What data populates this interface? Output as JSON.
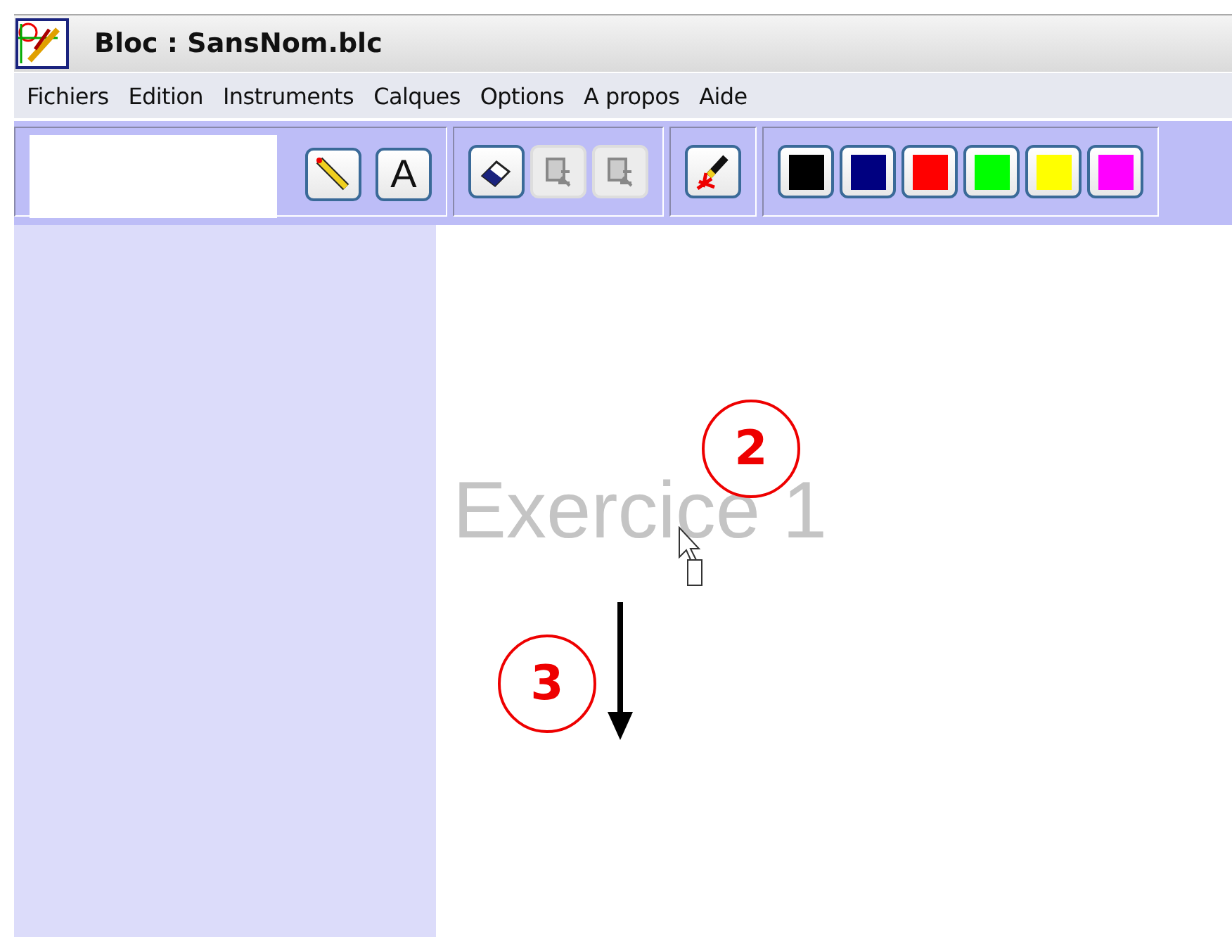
{
  "window": {
    "title": "Bloc : SansNom.blc"
  },
  "menu": [
    "Fichiers",
    "Edition",
    "Instruments",
    "Calques",
    "Options",
    "A propos",
    "Aide"
  ],
  "toolbar": {
    "tool_groups": [
      {
        "tools": [
          {
            "kind": "pencil",
            "disabled": false
          },
          {
            "kind": "text",
            "label": "A",
            "disabled": false
          }
        ]
      },
      {
        "tools": [
          {
            "kind": "eraser",
            "disabled": false
          },
          {
            "kind": "copy",
            "disabled": true
          },
          {
            "kind": "paste",
            "disabled": true
          }
        ]
      },
      {
        "tools": [
          {
            "kind": "marker",
            "disabled": false
          }
        ]
      }
    ],
    "colors": [
      {
        "color": "#000000"
      },
      {
        "color": "#000080"
      },
      {
        "color": "#ff0000"
      },
      {
        "color": "#00ff00"
      },
      {
        "color": "#ffff00"
      },
      {
        "color": "#ff00ff"
      }
    ]
  },
  "canvas": {
    "text": "Exercice 1",
    "annotations": [
      "2",
      "3"
    ]
  }
}
